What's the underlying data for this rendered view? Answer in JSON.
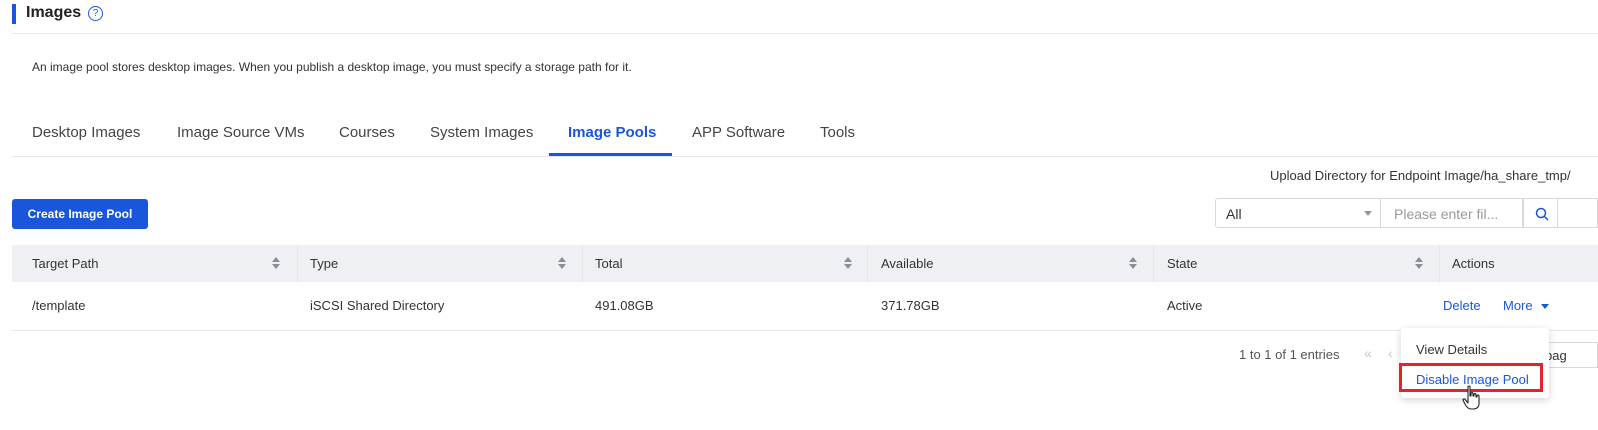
{
  "header": {
    "title": "Images",
    "help_icon": "question-circle-icon"
  },
  "description": "An image pool stores desktop images. When you publish a desktop image, you must specify a storage path for it.",
  "tabs": [
    {
      "label": "Desktop Images"
    },
    {
      "label": "Image Source VMs"
    },
    {
      "label": "Courses"
    },
    {
      "label": "System Images"
    },
    {
      "label": "Image Pools",
      "active": true
    },
    {
      "label": "APP Software"
    },
    {
      "label": "Tools"
    }
  ],
  "upload_directory": "Upload Directory for Endpoint Image/ha_share_tmp/",
  "toolbar": {
    "create_label": "Create Image Pool"
  },
  "filter": {
    "select_value": "All",
    "search_placeholder": "Please enter fil..."
  },
  "table": {
    "columns": [
      "Target Path",
      "Type",
      "Total",
      "Available",
      "State",
      "Actions"
    ],
    "rows": [
      {
        "target_path": "/template",
        "type": "iSCSI Shared Directory",
        "total": "491.08GB",
        "available": "371.78GB",
        "state": "Active",
        "actions": [
          "Delete",
          "More"
        ]
      }
    ]
  },
  "pagination": {
    "summary": "1 to 1 of 1 entries",
    "first": "«",
    "prev": "‹",
    "page_size_text": "pag"
  },
  "more_menu": {
    "items": [
      "View Details",
      "Disable Image Pool"
    ]
  },
  "colors": {
    "accent": "#1a56db",
    "highlight": "#e3242b"
  }
}
